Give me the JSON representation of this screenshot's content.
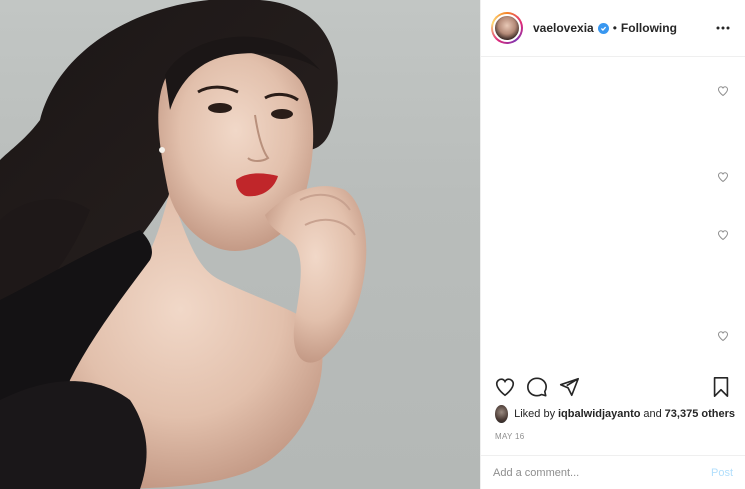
{
  "post": {
    "photo": {
      "alt_description": ""
    },
    "header": {
      "username": "vaelovexia",
      "verified": true,
      "separator": "•",
      "follow_status": "Following",
      "more_icon": "ellipsis-icon"
    },
    "comments": {
      "heart_icon": "heart-outline-icon",
      "count_visible": 4
    },
    "actions": {
      "like_icon": "heart-outline-icon",
      "comment_icon": "comment-icon",
      "share_icon": "paper-plane-icon",
      "save_icon": "bookmark-icon"
    },
    "likes": {
      "prefix": "Liked by",
      "liker": "iqbalwidjayanto",
      "connector": "and",
      "others": "73,375 others"
    },
    "date": "MAY 16",
    "comment_box": {
      "placeholder": "Add a comment...",
      "post_label": "Post"
    }
  },
  "colors": {
    "accent": "#3897f0",
    "post_disabled": "#b2dffc",
    "muted_text": "#8e8e8e",
    "lipstick": "#c0262a"
  }
}
